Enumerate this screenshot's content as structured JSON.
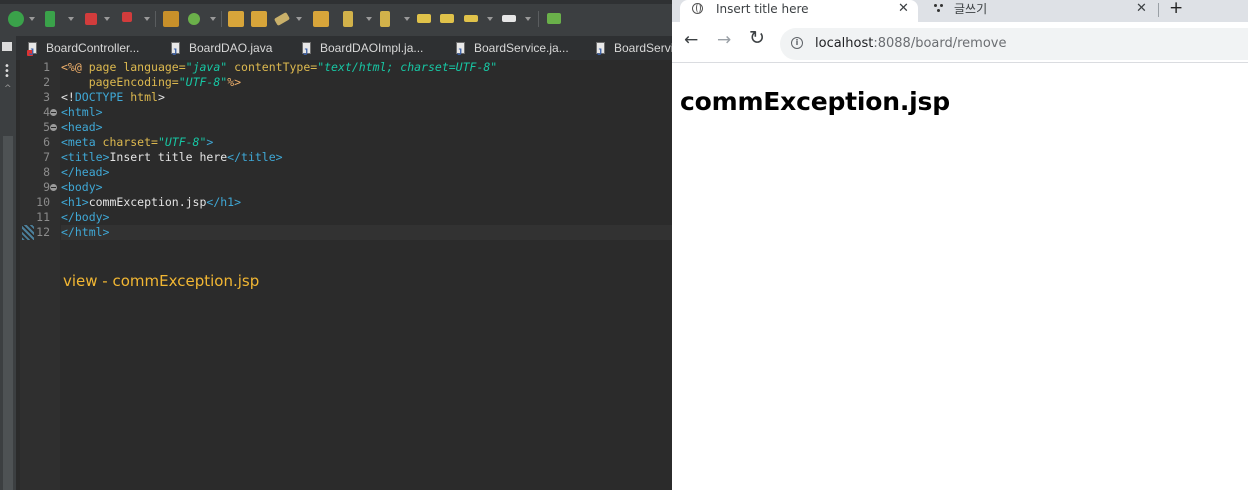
{
  "ide": {
    "editor_tabs": [
      {
        "label": "BoardController...",
        "has_error": true
      },
      {
        "label": "BoardDAO.java",
        "has_error": false
      },
      {
        "label": "BoardDAOImpl.ja...",
        "has_error": false
      },
      {
        "label": "BoardService.ja...",
        "has_error": false
      },
      {
        "label": "BoardServi",
        "has_error": false
      }
    ],
    "line_numbers": [
      "1",
      "2",
      "3",
      "4",
      "5",
      "6",
      "7",
      "8",
      "9",
      "10",
      "11",
      "12"
    ],
    "code": {
      "l1": {
        "open": "<%@ ",
        "page": "page ",
        "attr1": "language=",
        "val1": "\"java\"",
        "attr2": " contentType=",
        "val2": "\"text/html; charset=UTF-8\""
      },
      "l2": {
        "indent": "    ",
        "attr": "pageEncoding=",
        "val": "\"UTF-8\"",
        "close": "%>"
      },
      "l3": {
        "open": "<!",
        "doctype": "DOCTYPE",
        "rest": " html",
        "close": ">"
      },
      "l4": {
        "tag": "<html>"
      },
      "l5": {
        "tag": "<head>"
      },
      "l6": {
        "open": "<meta ",
        "attr": "charset=",
        "val": "\"UTF-8\"",
        "close": ">"
      },
      "l7": {
        "open": "<title>",
        "text": "Insert title here",
        "close": "</title>"
      },
      "l8": {
        "tag": "</head>"
      },
      "l9": {
        "tag": "<body>"
      },
      "l10": {
        "open": "<h1>",
        "text": "commException.jsp",
        "close": "</h1>"
      },
      "l11": {
        "tag": "</body>"
      },
      "l12": {
        "tag": "</html>"
      }
    },
    "annotation": "view - commException.jsp"
  },
  "browser": {
    "tabs": [
      {
        "title": "Insert title here",
        "active": true,
        "icon": "globe-icon"
      },
      {
        "title": "글쓰기",
        "active": false,
        "icon": "dots-icon"
      }
    ],
    "new_tab_symbol": "+",
    "close_symbol": "✕",
    "url_host": "localhost",
    "url_rest": ":8088/board/remove",
    "page_heading": "commException.jsp"
  },
  "colors": {
    "ide_bg": "#2b2b2b",
    "tag": "#3fa8d6",
    "attr": "#ddb94f",
    "value": "#17c6a3",
    "annotation": "#f2b733"
  }
}
